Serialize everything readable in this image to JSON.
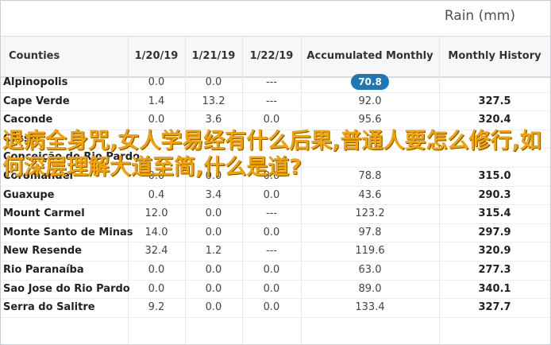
{
  "title": "Rain (mm)",
  "columns": [
    "Counties",
    "1/20/19",
    "1/21/19",
    "1/22/19",
    "Accumulated Monthly",
    "Monthly History"
  ],
  "rows": [
    {
      "name": "Alpinopolis",
      "d1": "0.0",
      "d2": "0.0",
      "d3": "---",
      "acc": "70.8",
      "hist": "",
      "highlight": true
    },
    {
      "name": "Cape Verde",
      "d1": "1.4",
      "d2": "13.2",
      "d3": "---",
      "acc": "92.0",
      "hist": "327.5"
    },
    {
      "name": "Caconde",
      "d1": "0.0",
      "d2": "3.6",
      "d3": "0.0",
      "acc": "95.6",
      "hist": "320.4"
    },
    {
      "name": "Cássia",
      "d1": "",
      "d2": "",
      "d3": "",
      "acc": "",
      "hist": ""
    },
    {
      "name": "Conceição do Rio Pardo",
      "d1": "",
      "d2": "",
      "d3": "",
      "acc": "",
      "hist": ""
    },
    {
      "name": "Coromandel",
      "d1": "0.0",
      "d2": "0.0",
      "d3": "0.0",
      "acc": "78.8",
      "hist": "315.0"
    },
    {
      "name": "Guaxupe",
      "d1": "0.4",
      "d2": "3.4",
      "d3": "0.0",
      "acc": "43.6",
      "hist": "290.3"
    },
    {
      "name": "Mount Carmel",
      "d1": "12.0",
      "d2": "0.0",
      "d3": "---",
      "acc": "123.2",
      "hist": "315.4"
    },
    {
      "name": "Monte Santo de Minas",
      "d1": "14.0",
      "d2": "0.0",
      "d3": "0.0",
      "acc": "97.8",
      "hist": "297.9"
    },
    {
      "name": "New Resende",
      "d1": "32.4",
      "d2": "1.2",
      "d3": "---",
      "acc": "119.6",
      "hist": "320.9"
    },
    {
      "name": "Rio Paranaíba",
      "d1": "0.0",
      "d2": "0.0",
      "d3": "0.0",
      "acc": "63.0",
      "hist": "277.3"
    },
    {
      "name": "Sao Jose do Rio Pardo",
      "d1": "0.0",
      "d2": "0.0",
      "d3": "0.0",
      "acc": "89.0",
      "hist": "340.1"
    },
    {
      "name": "Serra do Salitre",
      "d1": "9.2",
      "d2": "0.0",
      "d3": "0.0",
      "acc": "133.4",
      "hist": "327.7"
    }
  ],
  "overlay_text": "退病全身咒,女人学易经有什么后果,普通人要怎么修行,如何深层理解大道至简,什么是道?",
  "colors": {
    "badge": "#1f77b4",
    "overlay": "#f5a300"
  }
}
